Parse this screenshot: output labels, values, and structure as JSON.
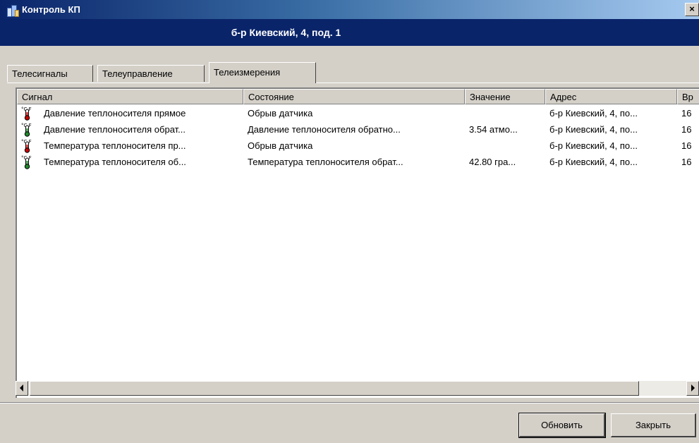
{
  "window": {
    "title": "Контроль КП",
    "close_label": "×"
  },
  "header": {
    "location": "б-р Киевский, 4, под. 1"
  },
  "tabs": [
    {
      "label": "Телесигналы",
      "active": false
    },
    {
      "label": "Телеуправление",
      "active": false
    },
    {
      "label": "Телеизмерения",
      "active": true
    }
  ],
  "table": {
    "columns": [
      "Сигнал",
      "Состояние",
      "Значение",
      "Адрес",
      "Вр"
    ],
    "rows": [
      {
        "icon": "thermometer-red-icon",
        "signal": "Давление теплоносителя прямое",
        "state": "Обрыв датчика",
        "value": "",
        "address": "б-р Киевский, 4, по...",
        "time": "16"
      },
      {
        "icon": "thermometer-green-icon",
        "signal": "Давление теплоносителя обрат...",
        "state": "Давление теплоносителя обратно...",
        "value": "3.54 атмо...",
        "address": "б-р Киевский, 4, по...",
        "time": "16"
      },
      {
        "icon": "thermometer-red-icon",
        "signal": "Температура теплоносителя пр...",
        "state": "Обрыв датчика",
        "value": "",
        "address": "б-р Киевский, 4, по...",
        "time": "16"
      },
      {
        "icon": "thermometer-green-icon",
        "signal": "Температура теплоносителя об...",
        "state": "Температура теплоносителя обрат...",
        "value": "42.80 гра...",
        "address": "б-р Киевский, 4, по...",
        "time": "16"
      }
    ],
    "icon_unit_label": "°C F"
  },
  "buttons": {
    "refresh": "Обновить",
    "close": "Закрыть"
  },
  "colors": {
    "title_bar_start": "#0a246a",
    "title_bar_end": "#a6caf0",
    "alarm_red": "#cc0000",
    "ok_green": "#1f8a2a"
  }
}
